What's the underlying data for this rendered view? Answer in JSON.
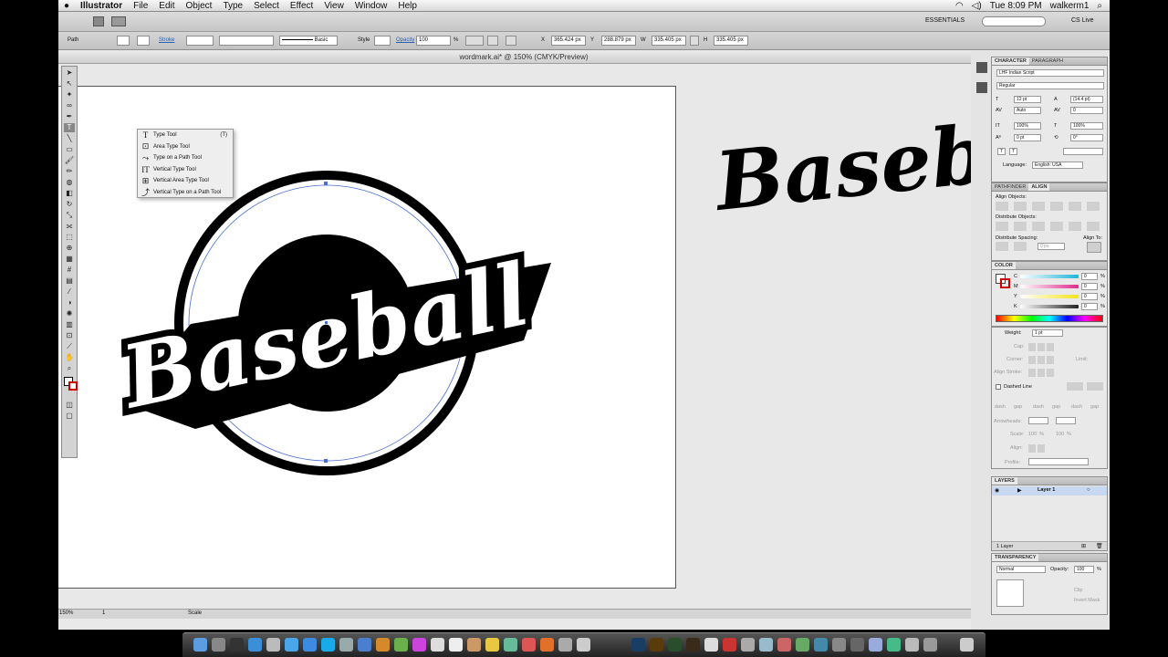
{
  "menubar": {
    "app_name": "Illustrator",
    "items": [
      "File",
      "Edit",
      "Object",
      "Type",
      "Select",
      "Effect",
      "View",
      "Window",
      "Help"
    ],
    "clock": "Tue 8:09 PM",
    "user": "walkerm1"
  },
  "appbar": {
    "workspace": "ESSENTIALS",
    "cs_live": "CS Live"
  },
  "control_bar": {
    "selection": "Path",
    "stroke_label": "Stroke",
    "stroke_style": "Basic",
    "style_label": "Style",
    "opacity_label": "Opacity",
    "opacity_value": "100",
    "opacity_unit": "%",
    "x_label": "X",
    "x_value": "365.424 px",
    "y_label": "Y",
    "y_value": "288.879 px",
    "w_label": "W",
    "w_value": "335.405 px",
    "h_label": "H",
    "h_value": "335.405 px"
  },
  "document": {
    "title": "wordmark.ai* @ 150% (CMYK/Preview)",
    "artwork_text": "Baseball",
    "zoom": "150%"
  },
  "status_bar": {
    "zoom": "150%",
    "page": "1",
    "info": "Scale"
  },
  "type_flyout": {
    "items": [
      {
        "icon": "T",
        "label": "Type Tool",
        "shortcut": "(T)"
      },
      {
        "icon": "⊡",
        "label": "Area Type Tool",
        "shortcut": ""
      },
      {
        "icon": "⤳",
        "label": "Type on a Path Tool",
        "shortcut": ""
      },
      {
        "icon": "IT",
        "label": "Vertical Type Tool",
        "shortcut": ""
      },
      {
        "icon": "⊞",
        "label": "Vertical Area Type Tool",
        "shortcut": ""
      },
      {
        "icon": "⤴",
        "label": "Vertical Type on a Path Tool",
        "shortcut": ""
      }
    ]
  },
  "character_panel": {
    "tabs": [
      "CHARACTER",
      "PARAGRAPH"
    ],
    "font": "LHF Indian Script",
    "style": "Regular",
    "size": "12 pt",
    "leading": "(14.4 pt)",
    "kerning": "Auto",
    "tracking": "0",
    "vscale": "100%",
    "hscale": "100%",
    "baseline": "0 pt",
    "rotation": "0°",
    "language_label": "Language:",
    "language": "English: USA"
  },
  "align_panel": {
    "tabs": [
      "PATHFINDER",
      "ALIGN"
    ],
    "align_objects": "Align Objects:",
    "distribute_objects": "Distribute Objects:",
    "distribute_spacing": "Distribute Spacing:",
    "align_to": "Align To:",
    "spacing_value": "0 px"
  },
  "color_panel": {
    "title": "COLOR",
    "channels": [
      {
        "label": "C",
        "value": "0",
        "unit": "%",
        "color": "#1fb6d9"
      },
      {
        "label": "M",
        "value": "0",
        "unit": "%",
        "color": "#e02a8c"
      },
      {
        "label": "Y",
        "value": "0",
        "unit": "%",
        "color": "#f2e51a"
      },
      {
        "label": "K",
        "value": "0",
        "unit": "%",
        "color": "#222222"
      }
    ]
  },
  "stroke_panel": {
    "weight_label": "Weight:",
    "weight": "1 pt",
    "cap": "Cap:",
    "corner": "Corner:",
    "limit": "Limit:",
    "align_stroke": "Align Stroke:",
    "dashed_line": "Dashed Line",
    "dash_labels": [
      "dash",
      "gap",
      "dash",
      "gap",
      "dash",
      "gap"
    ],
    "arrowheads": "Arrowheads:",
    "scale": "Scale:",
    "scale_values": [
      "100",
      "%",
      "100",
      "%"
    ],
    "align": "Align:",
    "profile": "Profile:"
  },
  "layers_panel": {
    "title": "LAYERS",
    "layer_name": "Layer 1",
    "footer": "1 Layer"
  },
  "transparency_panel": {
    "title": "TRANSPARENCY",
    "mode": "Normal",
    "opacity_label": "Opacity:",
    "opacity": "100",
    "unit": "%",
    "clip": "Clip",
    "invert": "Invert Mask"
  }
}
